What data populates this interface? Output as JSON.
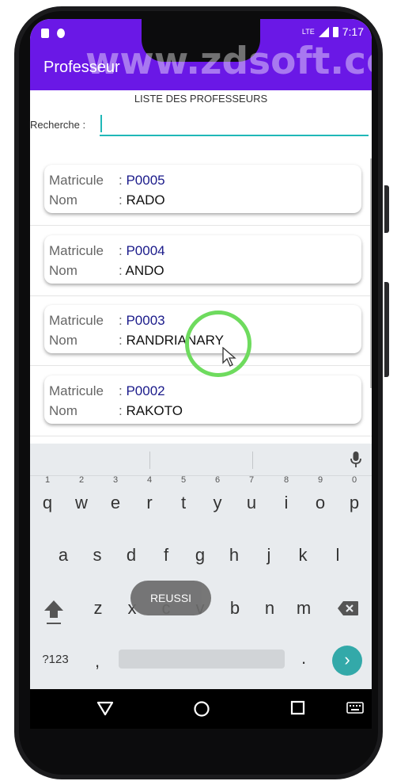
{
  "watermark": "www.zdsoft.com",
  "status_bar": {
    "time": "7:17",
    "network": "LTE"
  },
  "app_bar": {
    "title": "Professeur"
  },
  "list_header": "LISTE DES PROFESSEURS",
  "search": {
    "label": "Recherche :",
    "value": ""
  },
  "teachers": [
    {
      "matricule_label": "Matricule",
      "separator": ":",
      "matricule": "P0005",
      "nom_label": "Nom",
      "nom": "RADO"
    },
    {
      "matricule_label": "Matricule",
      "separator": ":",
      "matricule": "P0004",
      "nom_label": "Nom",
      "nom": "ANDO"
    },
    {
      "matricule_label": "Matricule",
      "separator": ":",
      "matricule": "P0003",
      "nom_label": "Nom",
      "nom": "RANDRIANARY"
    },
    {
      "matricule_label": "Matricule",
      "separator": ":",
      "matricule": "P0002",
      "nom_label": "Nom",
      "nom": "RAKOTO"
    }
  ],
  "toast": "REUSSI",
  "keyboard": {
    "row1": [
      "q",
      "w",
      "e",
      "r",
      "t",
      "y",
      "u",
      "i",
      "o",
      "p"
    ],
    "row1_hints": [
      "1",
      "2",
      "3",
      "4",
      "5",
      "6",
      "7",
      "8",
      "9",
      "0"
    ],
    "row2": [
      "a",
      "s",
      "d",
      "f",
      "g",
      "h",
      "j",
      "k",
      "l"
    ],
    "row3": [
      "z",
      "x",
      "c",
      "v",
      "b",
      "n",
      "m"
    ],
    "symbols_key": "?123",
    "comma_key": ",",
    "period_key": "."
  },
  "colors": {
    "app_bar": "#6a18e6",
    "accent": "#20b8b8",
    "matricule": "#1a1a8a",
    "tap_circle": "#6edb5e"
  },
  "icons": [
    "shift-icon",
    "backspace-icon",
    "mic-icon",
    "enter-icon",
    "back-icon",
    "home-icon",
    "recents-icon",
    "keyboard-switch-icon"
  ]
}
